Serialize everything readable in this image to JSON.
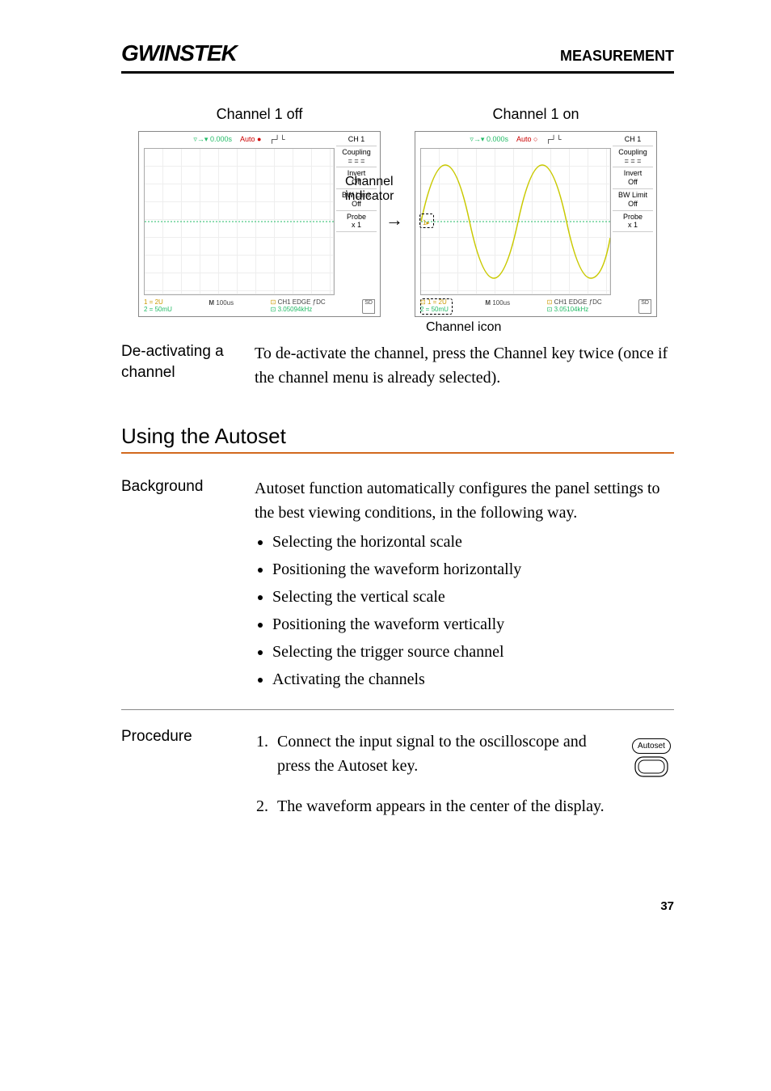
{
  "header": {
    "logo": "GWINSTEK",
    "page_title": "MEASUREMENT"
  },
  "scope_off": {
    "title": "Channel 1 off",
    "top_pos": "0.000s",
    "top_auto": "Auto",
    "menu": {
      "ch": "CH 1",
      "coupling": "Coupling",
      "invert": "Invert",
      "invert_val": "Off",
      "bw": "BW Limit",
      "bw_val": "Off",
      "probe": "Probe",
      "probe_val": "x 1"
    },
    "bottom": {
      "l1": "1 = 2U",
      "l2": "2 = 50mU",
      "time": "100us",
      "trig1": "CH1  EDGE",
      "trig_mode": "DC",
      "freq": "3.05094kHz"
    }
  },
  "scope_on": {
    "title": "Channel 1 on",
    "top_pos": "0.000s",
    "top_auto": "Auto",
    "menu": {
      "ch": "CH 1",
      "coupling": "Coupling",
      "invert": "Invert",
      "invert_val": "Off",
      "bw": "BW Limit",
      "bw_val": "Off",
      "probe": "Probe",
      "probe_val": "x 1"
    },
    "bottom": {
      "l1": "1 = 2U",
      "l2": "2 = 50mU",
      "time": "100us",
      "trig1": "CH1  EDGE",
      "trig_mode": "DC",
      "freq": "3.05104kHz"
    },
    "side_label_1": "Channel",
    "side_label_2": "indicator",
    "icon_label": "Channel icon"
  },
  "deactivate": {
    "label": "De-activating a channel",
    "text": "To de-activate the channel, press the Channel key twice (once if the channel menu is already selected)."
  },
  "section_title": "Using the Autoset",
  "background": {
    "label": "Background",
    "intro": "Autoset function automatically configures the panel settings to the best viewing conditions, in the following way.",
    "items": [
      "Selecting the horizontal scale",
      "Positioning the waveform horizontally",
      "Selecting the vertical scale",
      "Positioning the waveform vertically",
      "Selecting the trigger source channel",
      "Activating the channels"
    ]
  },
  "procedure": {
    "label": "Procedure",
    "steps": [
      "Connect the input signal to the oscilloscope and press the Autoset key.",
      "The waveform appears in the center of the display."
    ],
    "key_label": "Autoset"
  },
  "page_number": "37"
}
